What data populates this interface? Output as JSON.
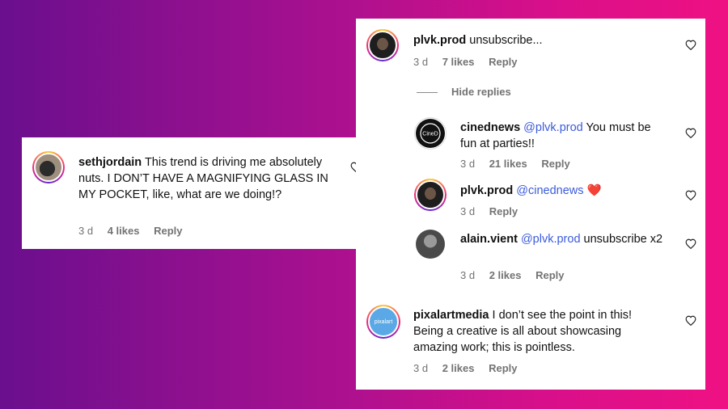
{
  "left_comment": {
    "username": "sethjordain",
    "text": "This trend is driving me absolutely nuts. I DON’T HAVE A MAGNIFYING GLASS IN MY POCKET, like, what are we doing!?",
    "time": "3 d",
    "likes": "4 likes",
    "reply": "Reply"
  },
  "thread": {
    "main": {
      "username": "plvk.prod",
      "text": "unsubscribe...",
      "time": "3 d",
      "likes": "7 likes",
      "reply": "Reply"
    },
    "hide_replies": "Hide replies",
    "replies": [
      {
        "username": "cinednews",
        "mention": "@plvk.prod",
        "text": "You must be fun at parties!!",
        "time": "3 d",
        "likes": "21 likes",
        "reply": "Reply",
        "avatar_label": "CineD"
      },
      {
        "username": "plvk.prod",
        "mention": "@cinednews",
        "text": "❤️",
        "time": "3 d",
        "reply": "Reply"
      },
      {
        "username": "alain.vient",
        "mention": "@plvk.prod",
        "text": "unsubscribe x2",
        "time": "3 d",
        "likes": "2 likes",
        "reply": "Reply"
      }
    ],
    "second": {
      "username": "pixalartmedia",
      "text": "I don’t see the point in this! Being a creative is all about showcasing amazing work; this is pointless.",
      "time": "3 d",
      "likes": "2 likes",
      "reply": "Reply",
      "avatar_label": "pixalart"
    }
  },
  "icons": [
    "heart-outline-icon"
  ],
  "colors": {
    "mention": "#3b5bdb",
    "meta": "#737373",
    "heart_emoji": "#e0245e"
  }
}
